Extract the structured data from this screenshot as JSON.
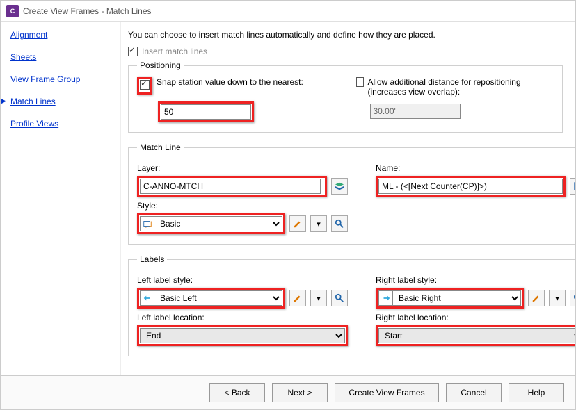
{
  "title": "Create View Frames - Match Lines",
  "app_icon_text": "C",
  "sidebar": {
    "items": [
      {
        "label": "Alignment"
      },
      {
        "label": "Sheets"
      },
      {
        "label": "View Frame Group"
      },
      {
        "label": "Match Lines"
      },
      {
        "label": "Profile Views"
      }
    ],
    "current_index": 3
  },
  "intro": "You can choose to insert match lines automatically and define how they are placed.",
  "insert_match_lines": {
    "label": "Insert match lines",
    "checked": true,
    "disabled": true
  },
  "positioning": {
    "legend": "Positioning",
    "snap_label": "Snap station value down to the nearest:",
    "snap_checked": true,
    "snap_value": "50",
    "allow_label": "Allow additional distance for repositioning (increases view overlap):",
    "allow_checked": false,
    "allow_value": "30.00'"
  },
  "matchline": {
    "legend": "Match Line",
    "layer_label": "Layer:",
    "layer_value": "C-ANNO-MTCH",
    "name_label": "Name:",
    "name_value": "ML - (<[Next Counter(CP)]>)",
    "style_label": "Style:",
    "style_value": "Basic"
  },
  "labels": {
    "legend": "Labels",
    "left_style_label": "Left label style:",
    "left_style_value": "Basic Left",
    "right_style_label": "Right label style:",
    "right_style_value": "Basic Right",
    "left_loc_label": "Left label location:",
    "left_loc_value": "End",
    "right_loc_label": "Right label location:",
    "right_loc_value": "Start"
  },
  "footer": {
    "back": "< Back",
    "next": "Next >",
    "create": "Create View Frames",
    "cancel": "Cancel",
    "help": "Help"
  }
}
